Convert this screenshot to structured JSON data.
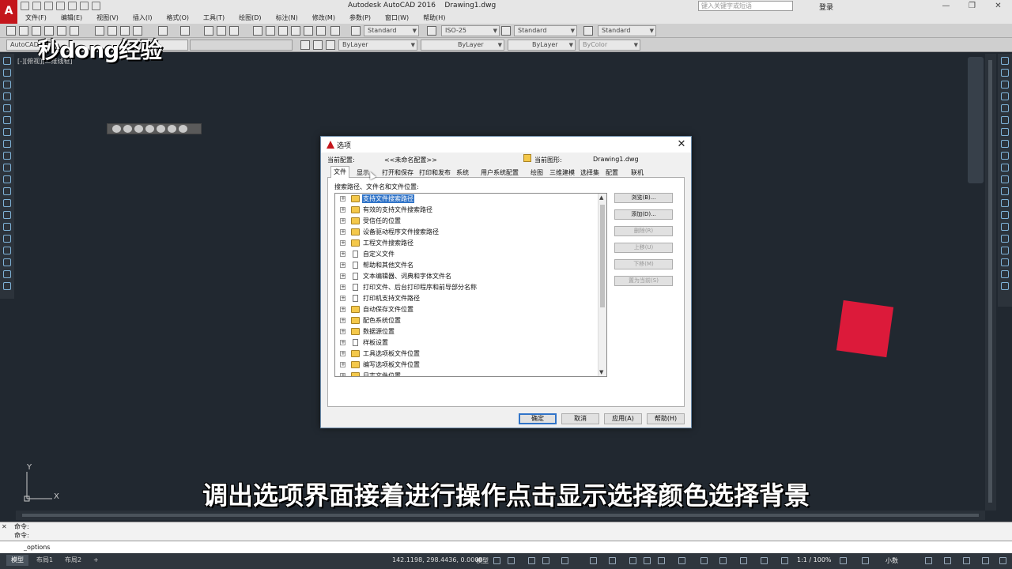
{
  "titlebar": {
    "app_logo": "A",
    "title": "Autodesk AutoCAD 2016    Drawing1.dwg",
    "search_placeholder": "键入关键字或短语",
    "login": "登录",
    "controls": [
      "—",
      "❐",
      "✕"
    ]
  },
  "menu": [
    "文件(F)",
    "编辑(E)",
    "视图(V)",
    "插入(I)",
    "格式(O)",
    "工具(T)",
    "绘图(D)",
    "标注(N)",
    "修改(M)",
    "参数(P)",
    "窗口(W)",
    "帮助(H)"
  ],
  "toolbar1": {
    "text_style": "Standard",
    "dim_style": "ISO-25",
    "table_style": "Standard",
    "mleader_style": "Standard"
  },
  "toolbar2": {
    "workspace": "AutoCAD 经典",
    "layer_color": "ByLayer",
    "linetype": "ByLayer",
    "lineweight": "ByLayer",
    "plotstyle": "ByColor"
  },
  "canvas": {
    "viewport_label": "[-][俯视][二维线框]",
    "watermark": "秒dong经验",
    "subtitle": "调出选项界面接着进行操作点击显示选择颜色选择背景",
    "ucs_x": "X",
    "ucs_y": "Y",
    "colors": {
      "background": "#212830",
      "square": "#dc1a3a"
    }
  },
  "dialog": {
    "title": "选项",
    "current_profile_label": "当前配置:",
    "current_profile_value": "<<未命名配置>>",
    "current_drawing_label": "当前图形:",
    "current_drawing_value": "Drawing1.dwg",
    "tabs": [
      "文件",
      "显示",
      "打开和保存",
      "打印和发布",
      "系统",
      "用户系统配置",
      "绘图",
      "三维建模",
      "选择集",
      "配置",
      "联机"
    ],
    "section_label": "搜索路径、文件名和文件位置:",
    "tree": [
      {
        "label": "支持文件搜索路径",
        "icon": "folder-icon"
      },
      {
        "label": "有效的支持文件搜索路径",
        "icon": "folder-icon"
      },
      {
        "label": "受信任的位置",
        "icon": "folder-icon"
      },
      {
        "label": "设备驱动程序文件搜索路径",
        "icon": "folder-icon"
      },
      {
        "label": "工程文件搜索路径",
        "icon": "folder-icon"
      },
      {
        "label": "自定义文件",
        "icon": "document-icon"
      },
      {
        "label": "帮助和其他文件名",
        "icon": "document-icon"
      },
      {
        "label": "文本编辑器、词典和字体文件名",
        "icon": "document-icon"
      },
      {
        "label": "打印文件、后台打印程序和前导部分名称",
        "icon": "document-icon"
      },
      {
        "label": "打印机支持文件路径",
        "icon": "document-icon"
      },
      {
        "label": "自动保存文件位置",
        "icon": "folder-icon"
      },
      {
        "label": "配色系统位置",
        "icon": "folder-icon"
      },
      {
        "label": "数据源位置",
        "icon": "folder-icon"
      },
      {
        "label": "样板设置",
        "icon": "document-icon"
      },
      {
        "label": "工具选项板文件位置",
        "icon": "folder-icon"
      },
      {
        "label": "编写选项板文件位置",
        "icon": "folder-icon"
      },
      {
        "label": "日志文件位置",
        "icon": "folder-icon"
      }
    ],
    "side_buttons": [
      "浏览(B)...",
      "添加(D)...",
      "删除(R)",
      "上移(U)",
      "下移(M)",
      "置为当前(S)"
    ],
    "footer_buttons": [
      "确定",
      "取消",
      "应用(A)",
      "帮助(H)"
    ]
  },
  "command": {
    "history": [
      "命令:",
      "命令:"
    ],
    "current": "_options"
  },
  "statusbar": {
    "tabs": [
      "模型",
      "布局1",
      "布局2"
    ],
    "add_tab": "+",
    "coords": "142.1198, 298.4436, 0.0000",
    "space": "模型",
    "scale": "1:1 / 100%",
    "units": "小数"
  }
}
